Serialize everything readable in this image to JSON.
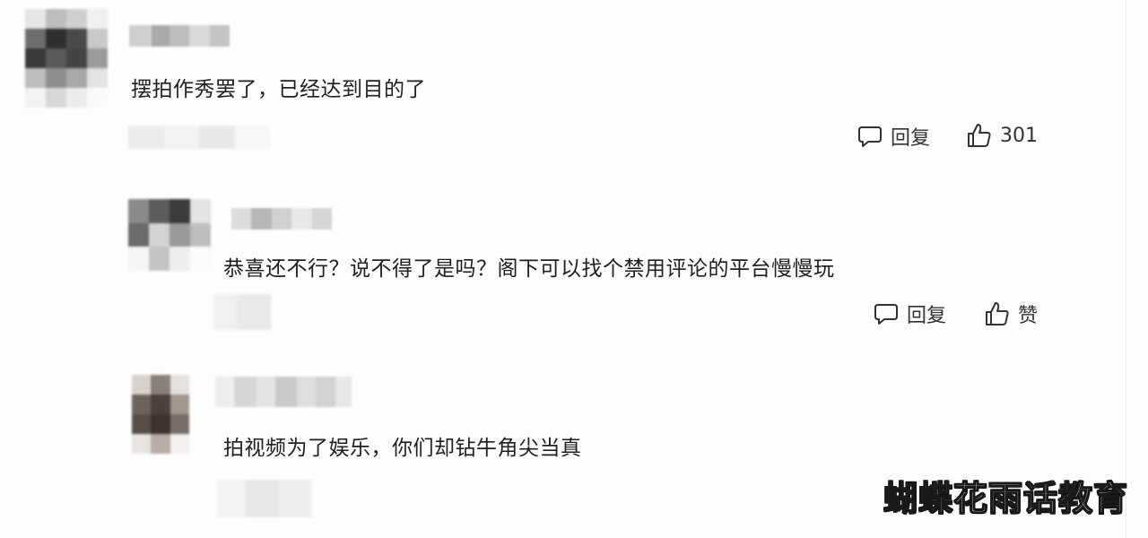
{
  "comments": [
    {
      "text": "摆拍作秀罢了，已经达到目的了",
      "reply_label": "回复",
      "like_label": "301"
    },
    {
      "text": "恭喜还不行？说不得了是吗？阁下可以找个禁用评论的平台慢慢玩",
      "reply_label": "回复",
      "like_label": "赞"
    },
    {
      "text": "拍视频为了娱乐，你们却钻牛角尖当真"
    }
  ],
  "watermark": "蝴蝶花雨话教育",
  "icons": {
    "reply": "comment-bubble-icon",
    "like": "thumbs-up-icon"
  }
}
